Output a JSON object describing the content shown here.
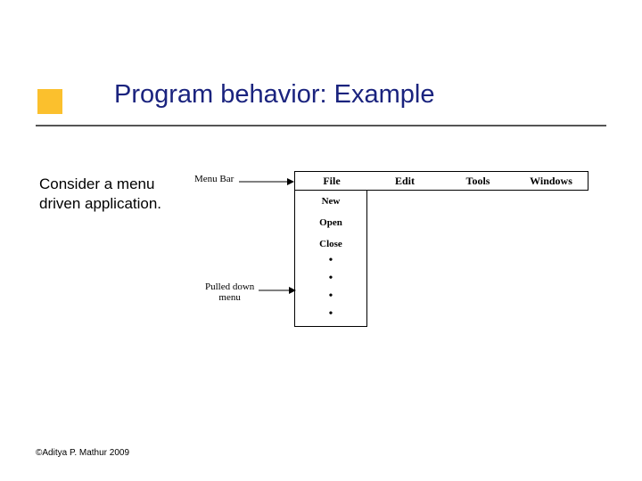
{
  "title": "Program behavior: Example",
  "body": {
    "line1": "Consider a menu",
    "line2": "driven application."
  },
  "diagram": {
    "menuBarLabel": "Menu Bar",
    "pulledDownLabel": "Pulled down\nmenu",
    "menuItems": [
      "File",
      "Edit",
      "Tools",
      "Windows"
    ],
    "dropdown": [
      "New",
      "Open",
      "Close"
    ]
  },
  "footer": "©Aditya P. Mathur 2009"
}
